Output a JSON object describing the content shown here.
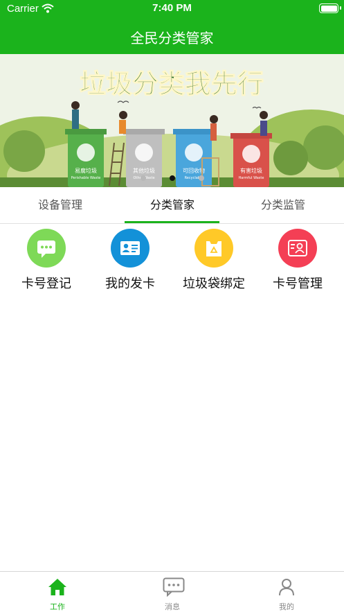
{
  "status_bar": {
    "carrier": "Carrier",
    "time": "7:40 PM"
  },
  "nav": {
    "title": "全民分类管家"
  },
  "banner": {
    "headline": "垃圾分类我先行",
    "bins": [
      {
        "label": "易腐垃圾",
        "sub": "Perishable Waste",
        "color": "#56b04b"
      },
      {
        "label": "其他垃圾",
        "sub": "Other Waste",
        "color": "#bfbfbf"
      },
      {
        "label": "可回收物",
        "sub": "Recyclable",
        "color": "#4aa6dc"
      },
      {
        "label": "有害垃圾",
        "sub": "Harmful Waste",
        "color": "#d9514a"
      }
    ],
    "page_count": 3,
    "active_page": 2
  },
  "tabs": [
    {
      "label": "设备管理",
      "active": false
    },
    {
      "label": "分类管家",
      "active": true
    },
    {
      "label": "分类监管",
      "active": false
    }
  ],
  "grid": [
    {
      "label": "卡号登记",
      "icon": "chat-card-icon",
      "color": "#7ed957"
    },
    {
      "label": "我的发卡",
      "icon": "id-card-icon",
      "color": "#1391d8"
    },
    {
      "label": "垃圾袋绑定",
      "icon": "recycle-bag-icon",
      "color": "#ffc928"
    },
    {
      "label": "卡号管理",
      "icon": "profile-card-icon",
      "color": "#f43f55"
    }
  ],
  "tabbar": [
    {
      "label": "工作",
      "icon": "home-icon",
      "active": true
    },
    {
      "label": "消息",
      "icon": "message-icon",
      "active": false
    },
    {
      "label": "我的",
      "icon": "user-icon",
      "active": false
    }
  ],
  "colors": {
    "primary": "#1bb31c"
  }
}
